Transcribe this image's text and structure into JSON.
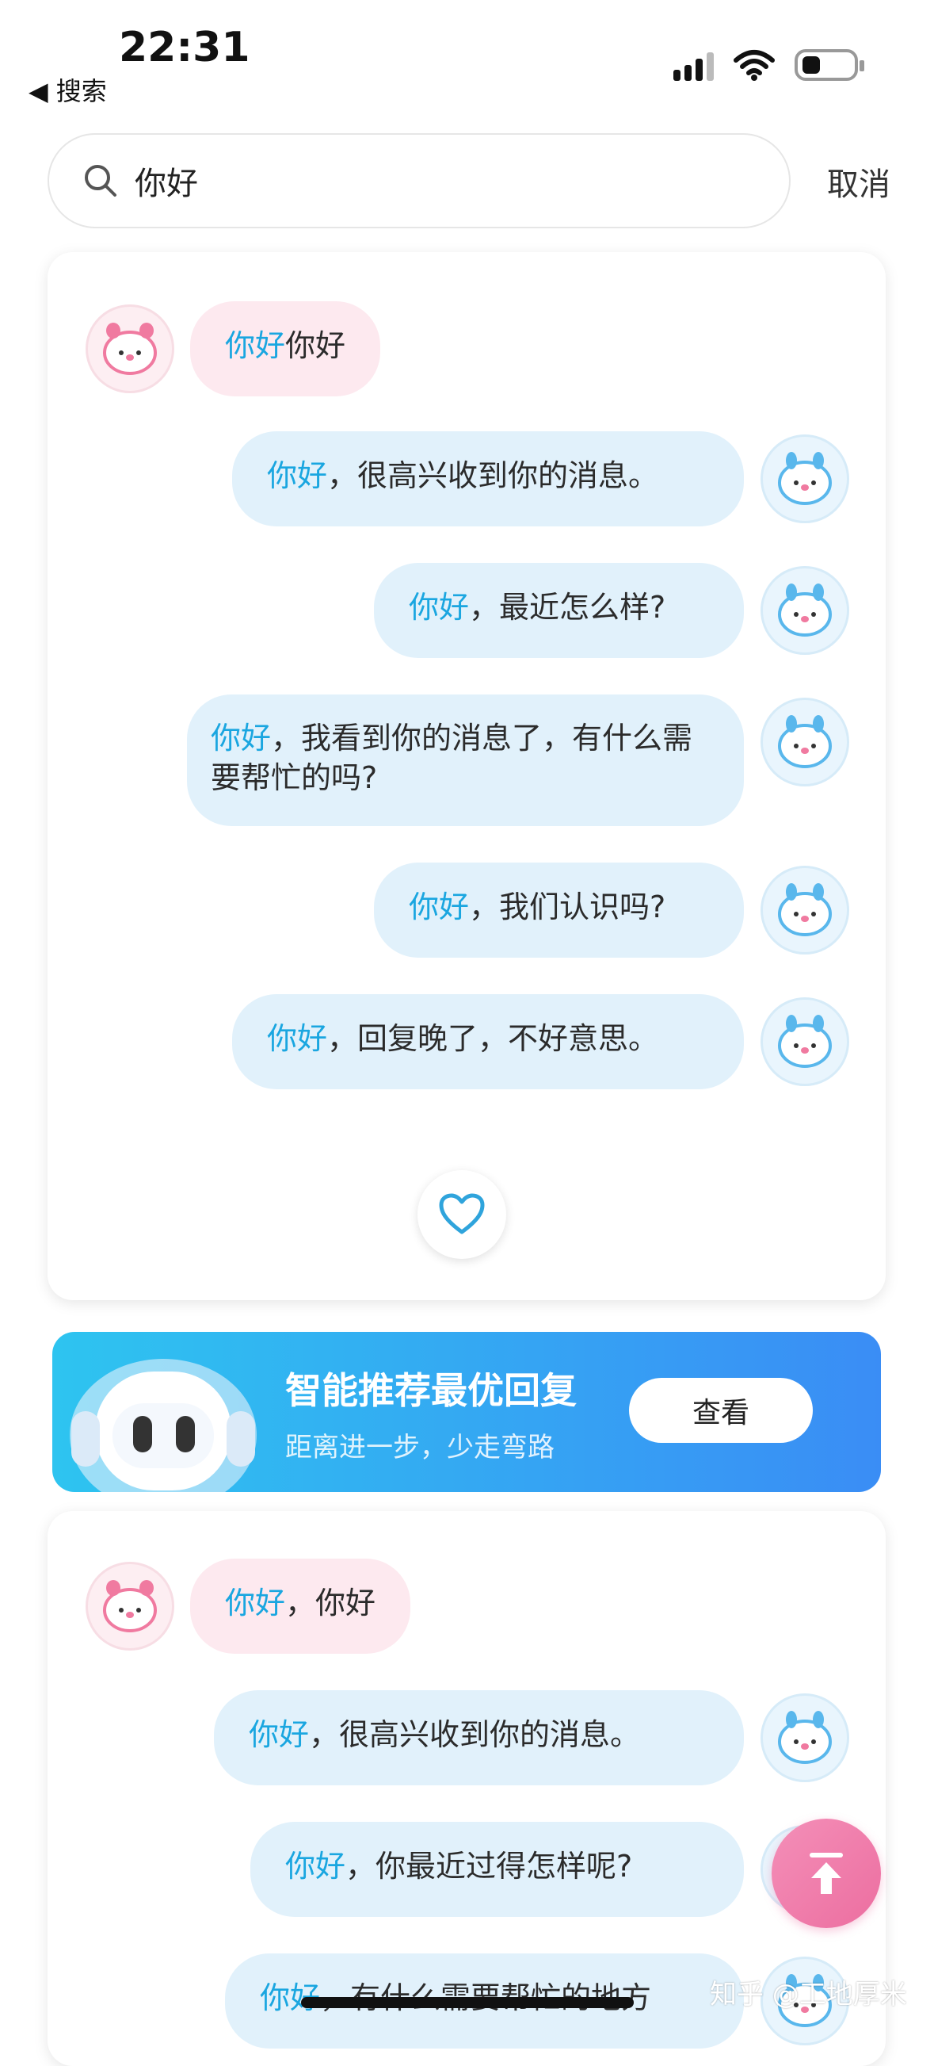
{
  "status_bar": {
    "time": "22:31",
    "back_label": "◀ 搜索"
  },
  "search": {
    "query": "你好",
    "cancel_label": "取消"
  },
  "card1": {
    "messages": [
      {
        "side": "left",
        "hl": "你好",
        "rest": "你好"
      },
      {
        "side": "right",
        "hl": "你好",
        "rest": "，很高兴收到你的消息。"
      },
      {
        "side": "right",
        "hl": "你好",
        "rest": "，最近怎么样?"
      },
      {
        "side": "right",
        "hl": "你好",
        "rest": "，我看到你的消息了，有什么需要帮忙的吗?"
      },
      {
        "side": "right",
        "hl": "你好",
        "rest": "，我们认识吗?"
      },
      {
        "side": "right",
        "hl": "你好",
        "rest": "，回复晚了，不好意思。"
      }
    ]
  },
  "banner": {
    "title": "智能推荐最优回复",
    "subtitle": "距离进一步，少走弯路",
    "button_label": "查看"
  },
  "card2": {
    "messages": [
      {
        "side": "left",
        "hl": "你好",
        "rest": "，你好"
      },
      {
        "side": "right",
        "hl": "你好",
        "rest": "，很高兴收到你的消息。"
      },
      {
        "side": "right",
        "hl": "你好",
        "rest": "，你最近过得怎样呢?"
      },
      {
        "side": "right",
        "hl": "你好",
        "rest": "，有什么需要帮忙的地方"
      }
    ]
  },
  "watermark": "知乎 @工地厚米",
  "colors": {
    "highlight": "#1aa6e0",
    "pink_bubble": "#fde9ef",
    "blue_bubble": "#e1f1fb",
    "banner_start": "#2ec4f0",
    "banner_end": "#3a8df5",
    "scroll_top": "#ec6ea0"
  },
  "icons": [
    "search-icon",
    "signal-icon",
    "wifi-icon",
    "battery-icon",
    "heart-icon",
    "robot-mascot-icon",
    "scroll-to-top-icon",
    "pink-avatar-icon",
    "blue-avatar-icon"
  ]
}
